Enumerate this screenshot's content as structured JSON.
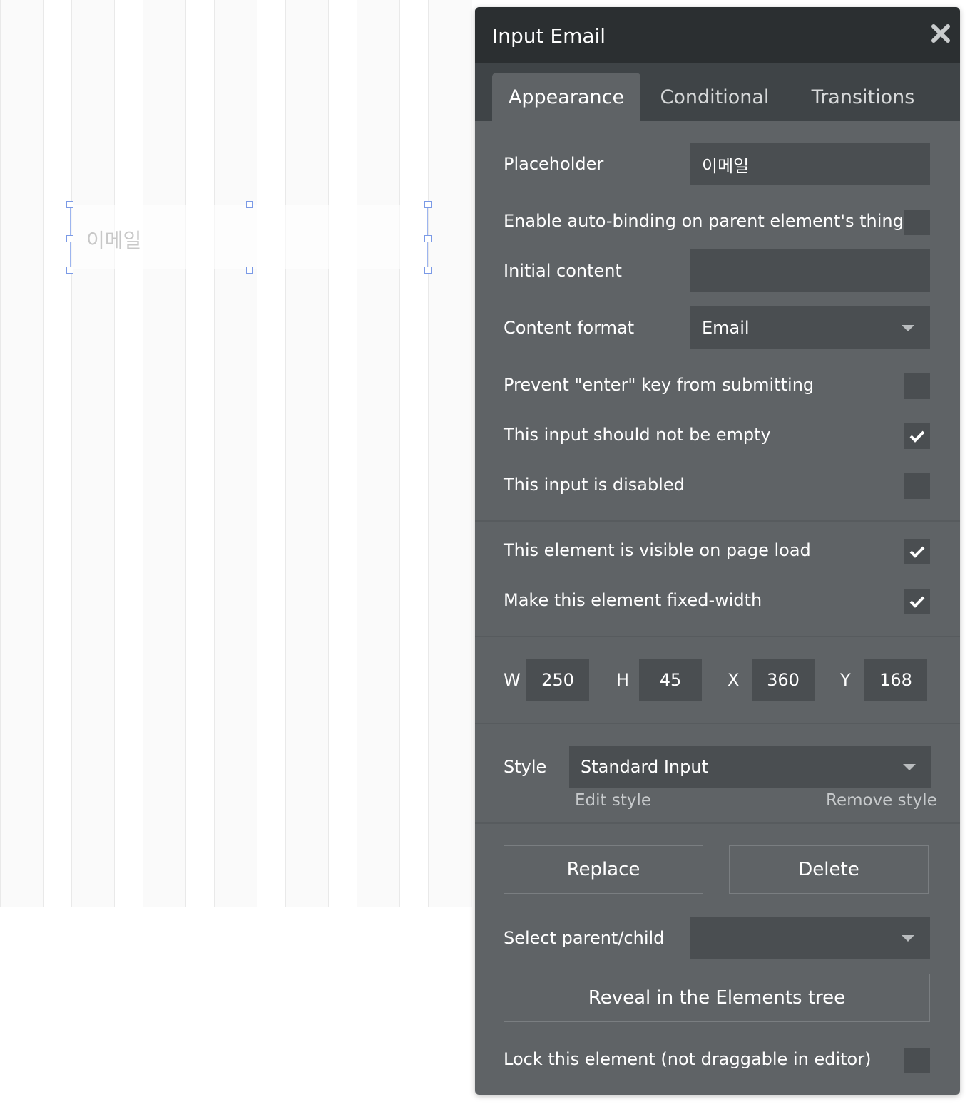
{
  "canvas": {
    "input_placeholder": "이메일"
  },
  "panel": {
    "title": "Input Email",
    "close_icon": "close-icon",
    "tabs": [
      {
        "label": "Appearance",
        "active": true
      },
      {
        "label": "Conditional",
        "active": false
      },
      {
        "label": "Transitions",
        "active": false
      }
    ],
    "placeholder": {
      "label": "Placeholder",
      "value": "이메일"
    },
    "auto_binding": {
      "label": "Enable auto-binding on parent element's thing",
      "checked": false
    },
    "initial_content": {
      "label": "Initial content",
      "value": ""
    },
    "content_format": {
      "label": "Content format",
      "value": "Email"
    },
    "prevent_enter": {
      "label": "Prevent \"enter\" key from submitting",
      "checked": false
    },
    "not_empty": {
      "label": "This input should not be empty",
      "checked": true
    },
    "disabled": {
      "label": "This input is disabled",
      "checked": false
    },
    "visible_on_load": {
      "label": "This element is visible on page load",
      "checked": true
    },
    "fixed_width": {
      "label": "Make this element fixed-width",
      "checked": true
    },
    "dimensions": {
      "w_label": "W",
      "w": "250",
      "h_label": "H",
      "h": "45",
      "x_label": "X",
      "x": "360",
      "y_label": "Y",
      "y": "168"
    },
    "style": {
      "label": "Style",
      "value": "Standard Input",
      "edit": "Edit style",
      "remove": "Remove style"
    },
    "replace_label": "Replace",
    "delete_label": "Delete",
    "select_parent": {
      "label": "Select parent/child",
      "value": ""
    },
    "reveal_label": "Reveal in the Elements tree",
    "lock": {
      "label": "Lock this element (not draggable in editor)",
      "checked": false
    }
  },
  "colors": {
    "panel_bg": "#5f6366",
    "header_bg": "#2b2f31",
    "tabbar_bg": "#3f4447",
    "field_bg": "#4a4e51",
    "selection": "#7b9ae6"
  }
}
